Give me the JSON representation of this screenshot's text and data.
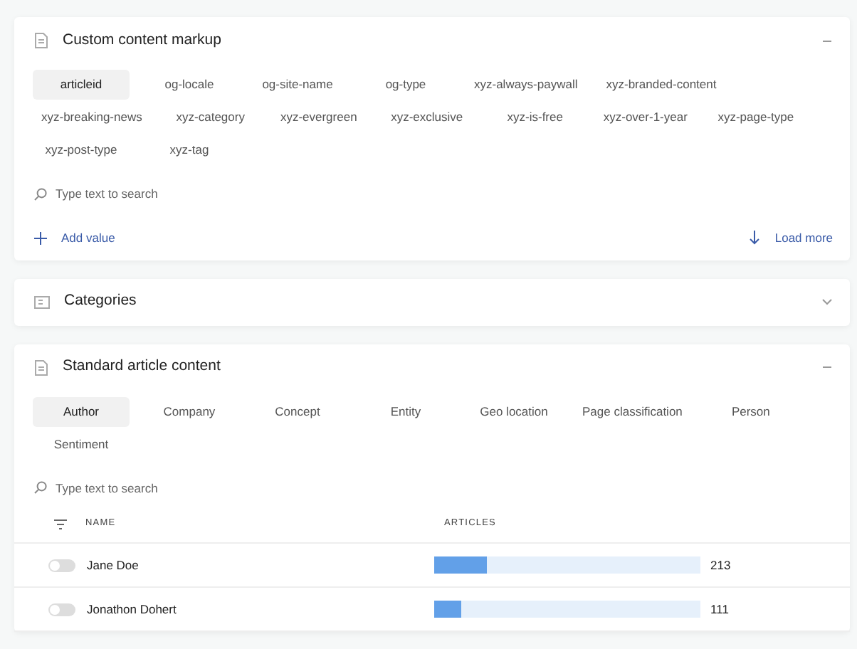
{
  "panels": [
    {
      "title": "Custom content markup",
      "kind": "markup",
      "expanded": true,
      "chips": [
        {
          "label": "articleid",
          "selected": true
        },
        {
          "label": "og-locale",
          "selected": false
        },
        {
          "label": "og-site-name",
          "selected": false
        },
        {
          "label": "og-type",
          "selected": false
        },
        {
          "label": "xyz-always-paywall",
          "selected": false
        },
        {
          "label": "xyz-branded-content",
          "selected": false
        },
        {
          "label": "xyz-breaking-news",
          "selected": false
        },
        {
          "label": "xyz-category",
          "selected": false
        },
        {
          "label": "xyz-evergreen",
          "selected": false
        },
        {
          "label": "xyz-exclusive",
          "selected": false
        },
        {
          "label": "xyz-is-free",
          "selected": false
        },
        {
          "label": "xyz-over-1-year",
          "selected": false
        },
        {
          "label": "xyz-page-type",
          "selected": false
        },
        {
          "label": "xyz-post-type",
          "selected": false
        },
        {
          "label": "xyz-tag",
          "selected": false
        }
      ],
      "search": {
        "placeholder": "Type text to search"
      },
      "add_button": "Add value",
      "load_button": "Load more"
    },
    {
      "title": "Categories",
      "kind": "categories",
      "expanded": false
    },
    {
      "title": "Standard article content",
      "kind": "article",
      "expanded": true,
      "chips": [
        {
          "label": "Author",
          "selected": true
        },
        {
          "label": "Company",
          "selected": false
        },
        {
          "label": "Concept",
          "selected": false
        },
        {
          "label": "Entity",
          "selected": false
        },
        {
          "label": "Geo location",
          "selected": false
        },
        {
          "label": "Page classification",
          "selected": false
        },
        {
          "label": "Person",
          "selected": false
        },
        {
          "label": "Sentiment",
          "selected": false
        }
      ],
      "search": {
        "placeholder": "Type text to search"
      },
      "table": {
        "columns": [
          "NAME",
          "ARTICLES"
        ],
        "rows": [
          {
            "on": false,
            "name": "Jane Doe",
            "level": 0.2,
            "count": "213"
          },
          {
            "on": false,
            "name": "Jonathon Dohert",
            "level": 0.1,
            "count": "111"
          }
        ]
      }
    }
  ]
}
